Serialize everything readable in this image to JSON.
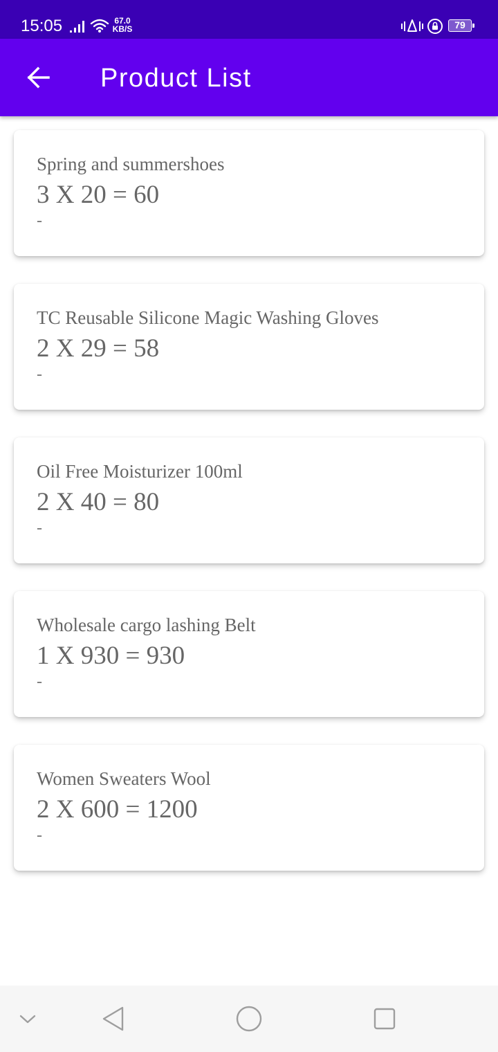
{
  "status_bar": {
    "time": "15:05",
    "net_speed_value": "67.0",
    "net_speed_unit": "KB/S",
    "battery_level": "79",
    "icons": [
      "signal-icon",
      "wifi-icon",
      "vibrate-icon",
      "lock-rotation-icon",
      "battery-icon"
    ]
  },
  "app_bar": {
    "title": "Product List",
    "back_icon": "arrow-left-icon",
    "background_color": "#6200ee"
  },
  "products": [
    {
      "name": "Spring and summershoes",
      "calc": "3 X 20 = 60",
      "note": "-"
    },
    {
      "name": "TC Reusable Silicone Magic Washing Gloves",
      "calc": "2 X 29 = 58",
      "note": "-"
    },
    {
      "name": "Oil Free Moisturizer 100ml",
      "calc": "2 X 40 = 80",
      "note": "-"
    },
    {
      "name": "Wholesale cargo lashing Belt",
      "calc": "1 X 930 = 930",
      "note": "-"
    },
    {
      "name": "Women Sweaters Wool",
      "calc": "2 X 600 = 1200",
      "note": "-"
    }
  ],
  "nav_bar": {
    "icons": [
      "chevron-down-icon",
      "back-triangle-icon",
      "home-circle-icon",
      "recents-square-icon"
    ]
  },
  "colors": {
    "status_bar": "#3a00b4",
    "app_bar": "#6200ee",
    "card_text": "#666666",
    "nav_bar": "#f6f6f6"
  }
}
